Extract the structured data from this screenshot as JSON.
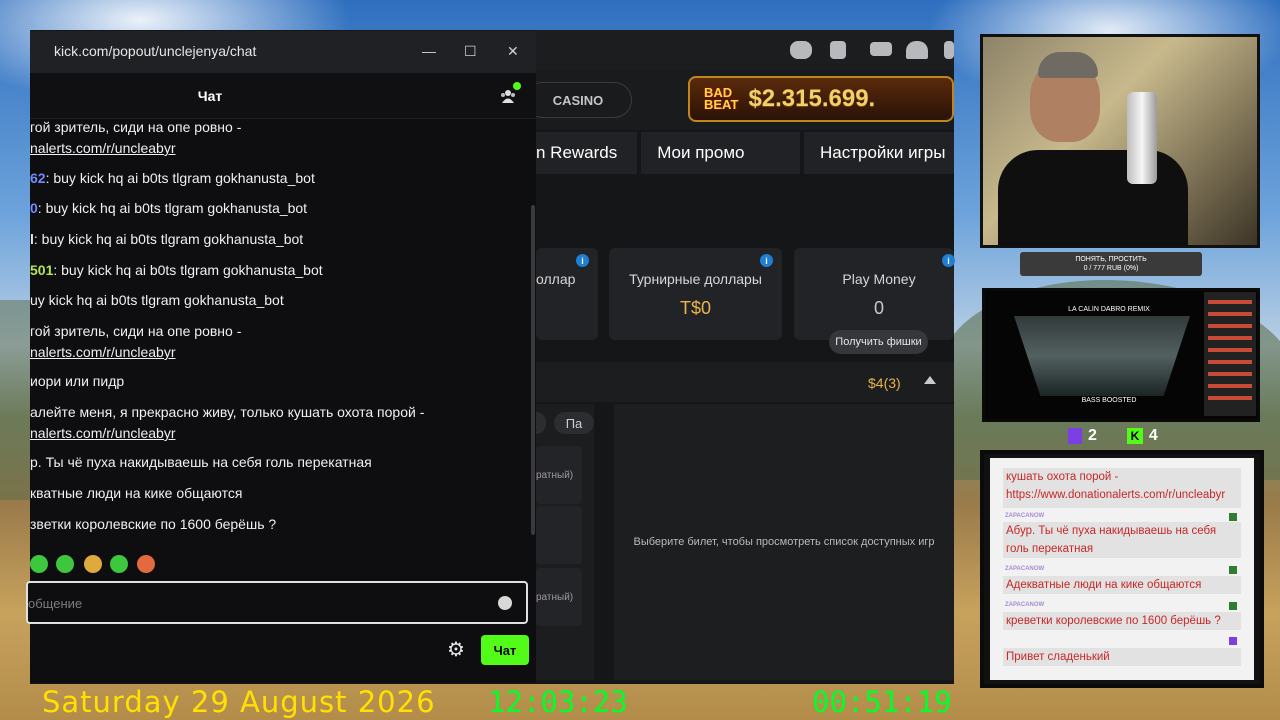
{
  "colors": {
    "kick_green": "#53fc18",
    "site_bg": "#151617",
    "jackpot_gold": "#f3d16a",
    "chat_link_text": "#f0f0f0",
    "clock_yellow": "#ffe000",
    "clock_green": "#00ff2a",
    "overlay_text_red": "#c62828"
  },
  "chat_window": {
    "url": "kick.com/popout/unclejenya/chat",
    "minimize": "—",
    "maximize": "☐",
    "close": "✕",
    "title": "Чат",
    "icons": {
      "users": "users-icon",
      "settings": "gear-icon",
      "emoji": "smile-icon"
    },
    "messages": [
      {
        "text": "гой зритель, сиди на опе ровно -"
      },
      {
        "link": "nalerts.com/r/uncleabyr"
      },
      {
        "user": "62",
        "user_color": "#6f8bff",
        "text": ": buy kick hq ai b0ts tlgram gokhanusta_bot"
      },
      {
        "user": "0",
        "user_color": "#6f8bff",
        "text": ": buy kick hq ai b0ts tlgram gokhanusta_bot"
      },
      {
        "user": "l",
        "user_color": "#e6e6e6",
        "text": ": buy kick hq ai b0ts tlgram gokhanusta_bot"
      },
      {
        "user": "501",
        "user_color": "#b7e34e",
        "text": ": buy kick hq ai b0ts tlgram gokhanusta_bot"
      },
      {
        "text": "uy kick hq ai b0ts tlgram gokhanusta_bot"
      },
      {
        "text": "гой зритель, сиди на опе ровно -"
      },
      {
        "link": "nalerts.com/r/uncleabyr"
      },
      {
        "text": "иори или пидр"
      },
      {
        "text": "алейте меня, я прекрасно живу, только кушать охота порой -"
      },
      {
        "link": "nalerts.com/r/uncleabyr"
      },
      {
        "text": "р. Ты чё пуха накидываешь на себя голь перекатная"
      },
      {
        "text": "кватные люди на кике общаются"
      },
      {
        "text": "зветки королевские по 1600 берёшь ?"
      }
    ],
    "input_placeholder": "общение",
    "send_label": "Чат"
  },
  "site": {
    "top_icons": [
      "chat-bubble-icon",
      "cube-icon",
      "mail-icon",
      "wifi-icon",
      "extension-icon"
    ],
    "casino_label": "CASINO",
    "jackpot_logo": [
      "BAD",
      "BEAT"
    ],
    "jackpot_amount": "$2.315.699.",
    "tabs": [
      "n Rewards",
      "Мои промо",
      "Настройки игры"
    ],
    "cards": [
      {
        "title": "оллар",
        "value": ""
      },
      {
        "title": "Турнирные доллары",
        "value": "T$0"
      },
      {
        "title": "Play Money",
        "value": "0"
      }
    ],
    "get_chips": "Получить фишки",
    "row_amount": "$4(3)",
    "pill_pa": "Па",
    "side_items": [
      "ратный)",
      "ратный)"
    ],
    "select_ticket_hint": "Выберите билет, чтобы просмотреть список доступных игр"
  },
  "overlay": {
    "goal_title": "ПОНЯТЬ, ПРОСТИТЬ",
    "goal_progress": "0 / 777 RUB (0%)",
    "video_title": "LA CALIN DABRO REMIX",
    "video_subtitle": "BASS BOOSTED",
    "twitch_viewers": "2",
    "kick_viewers": "4",
    "kick_glyph": "K",
    "chat": [
      {
        "name": "",
        "text": "кушать охота порой -\nhttps://www.donationalerts.com/r/uncleabyr"
      },
      {
        "name": "ZAPACANOW",
        "text": "Абур. Ты чё пуха накидываешь на себя голь перекатная"
      },
      {
        "name": "ZAPACANOW",
        "text": "Адекватные люди на кике общаются"
      },
      {
        "name": "ZAPACANOW",
        "text": "креветки королевские по 1600 берёшь ?"
      },
      {
        "name": "",
        "text": "Привет сладенький"
      }
    ]
  },
  "clock": {
    "date": "Saturday 29 August 2026",
    "time": "12:03:23",
    "uptime": "00:51:19"
  }
}
